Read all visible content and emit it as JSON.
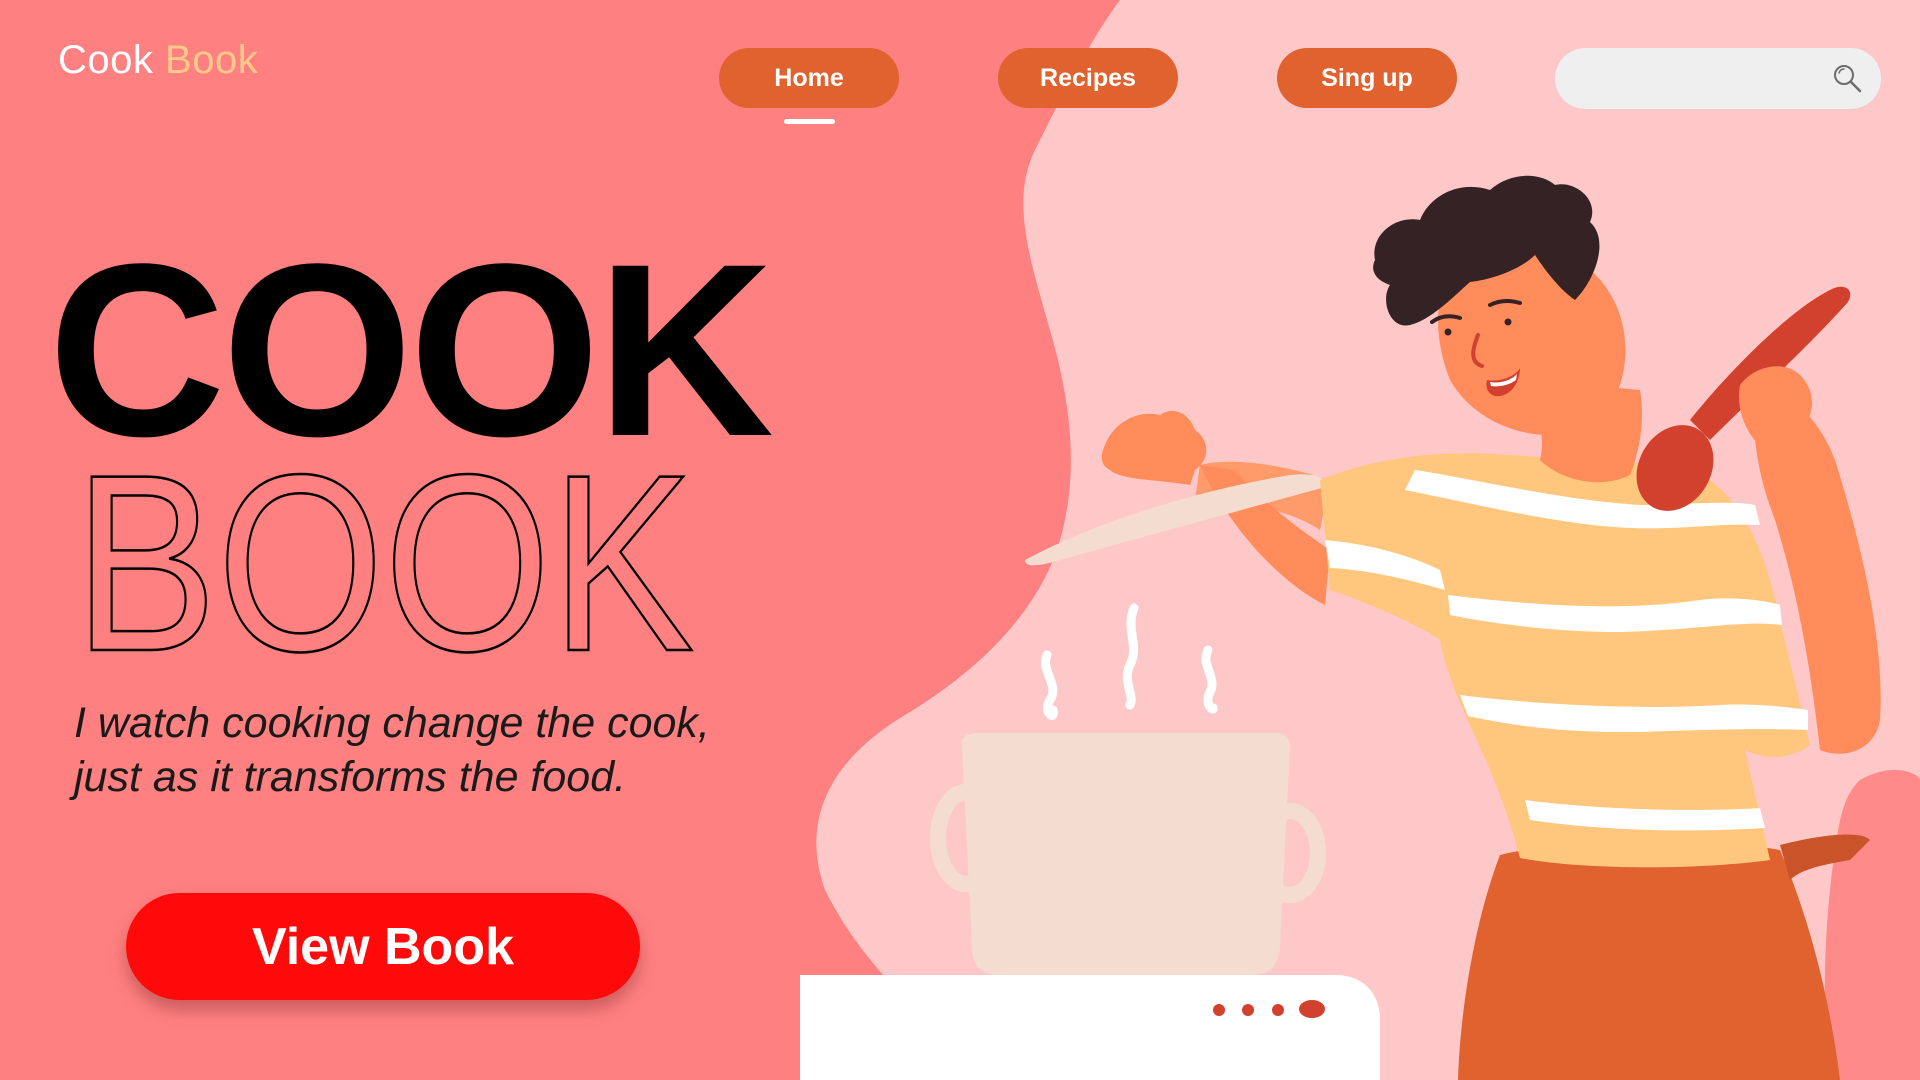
{
  "brand": {
    "name_primary": "Cook",
    "name_accent": "Book",
    "accent_color": "#ffc98a"
  },
  "nav": {
    "items": [
      {
        "label": "Home",
        "active": true
      },
      {
        "label": "Recipes",
        "active": false
      },
      {
        "label": "Sing up",
        "active": false
      }
    ],
    "button_color": "#e0622f"
  },
  "search": {
    "value": "",
    "icon": "search-icon"
  },
  "hero": {
    "title_line1": "COOK",
    "title_line2": "BOOK",
    "tagline_line1": "I watch cooking change the cook,",
    "tagline_line2": "just as it transforms the food.",
    "cta_label": "View Book",
    "cta_color": "#ff0a0a"
  },
  "colors": {
    "background": "#ff8080",
    "blob": "#ffc8c8"
  },
  "illustration": {
    "subject": "person-cooking-illustration"
  }
}
